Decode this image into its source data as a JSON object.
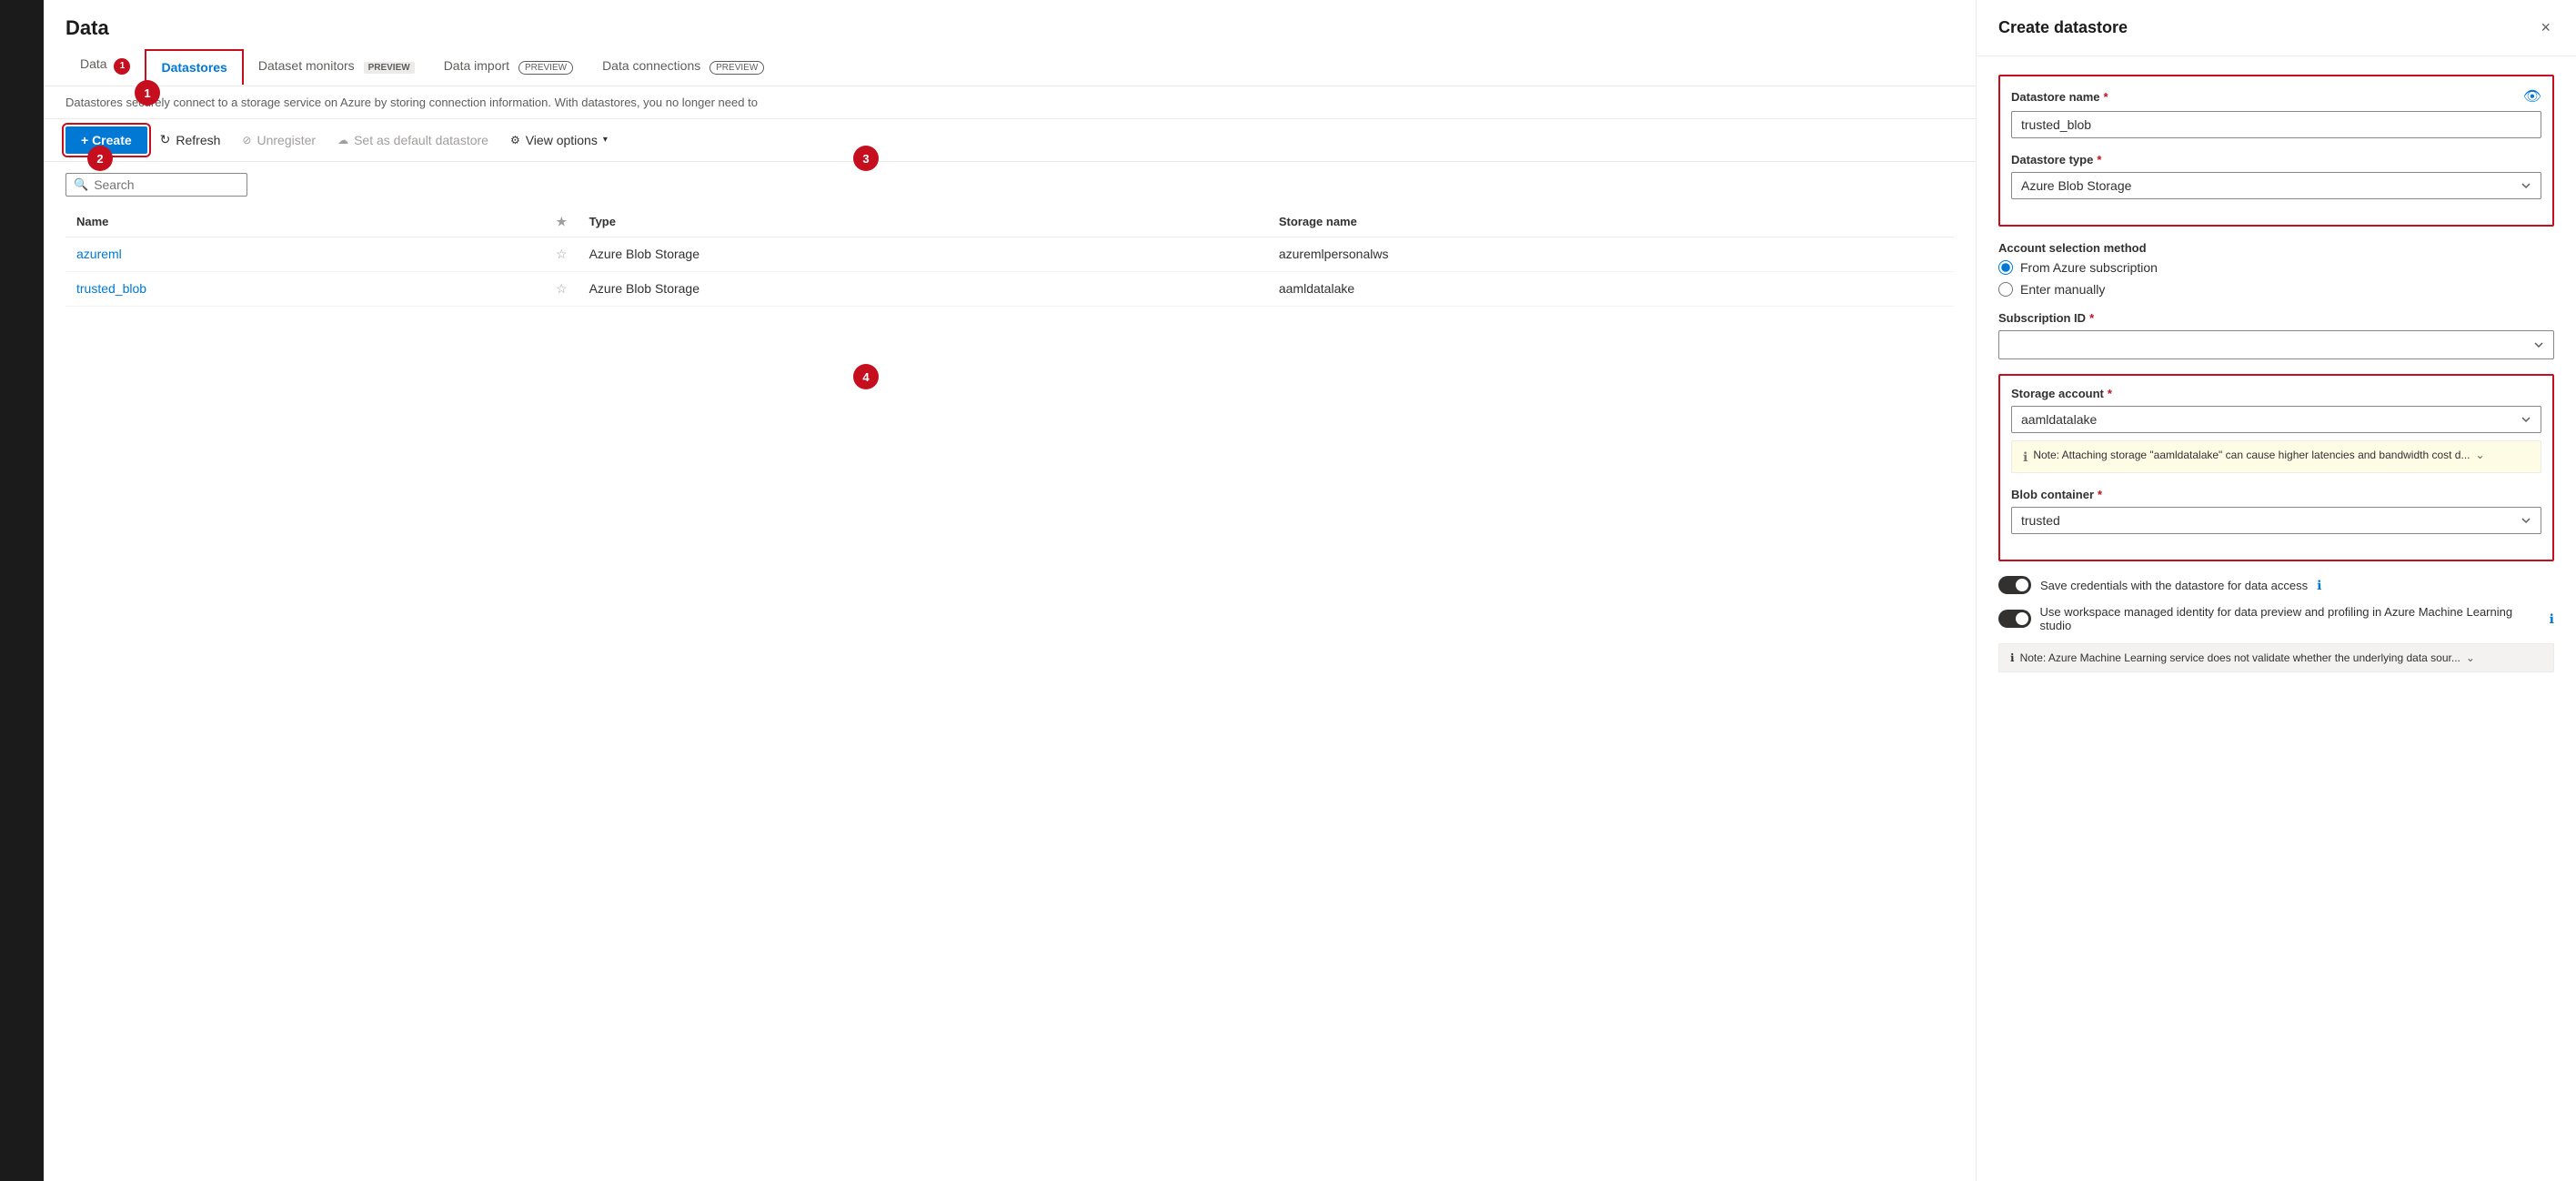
{
  "sidebar": {},
  "page": {
    "title": "Data"
  },
  "tabs": [
    {
      "id": "data",
      "label": "Data",
      "badge": "1",
      "badgeType": "circle",
      "active": false
    },
    {
      "id": "datastores",
      "label": "Datastores",
      "active": true
    },
    {
      "id": "dataset-monitors",
      "label": "Dataset monitors",
      "badge": "PREVIEW",
      "badgeType": "flat",
      "active": false
    },
    {
      "id": "data-import",
      "label": "Data import",
      "badge": "PREVIEW",
      "badgeType": "outline",
      "active": false
    },
    {
      "id": "data-connections",
      "label": "Data connections",
      "badge": "PREVIEW",
      "badgeType": "outline",
      "active": false
    }
  ],
  "description": "Datastores securely connect to a storage service on Azure by storing connection information. With datastores, you no longer need to",
  "toolbar": {
    "create_label": "+ Create",
    "refresh_label": "Refresh",
    "unregister_label": "Unregister",
    "set_default_label": "Set as default datastore",
    "view_options_label": "View options"
  },
  "search": {
    "placeholder": "Search"
  },
  "table": {
    "columns": [
      "Name",
      "",
      "Type",
      "Storage name"
    ],
    "rows": [
      {
        "name": "azureml",
        "type": "Azure Blob Storage",
        "storage": "azuremlpersonalws"
      },
      {
        "name": "trusted_blob",
        "type": "Azure Blob Storage",
        "storage": "aamldatalake"
      }
    ]
  },
  "steps": [
    {
      "number": "1"
    },
    {
      "number": "2"
    },
    {
      "number": "3"
    },
    {
      "number": "4"
    }
  ],
  "panel": {
    "title": "Create datastore",
    "close_label": "×",
    "datastore_name_label": "Datastore name",
    "datastore_name_value": "trusted_blob",
    "datastore_type_label": "Datastore type",
    "datastore_type_value": "Azure Blob Storage",
    "account_selection_label": "Account selection method",
    "radio_azure": "From Azure subscription",
    "radio_manual": "Enter manually",
    "subscription_id_label": "Subscription ID",
    "storage_account_label": "Storage account",
    "storage_account_value": "aamldatalake",
    "note_text": "Note: Attaching storage \"aamldatalake\" can cause higher latencies and bandwidth cost d...",
    "blob_container_label": "Blob container",
    "blob_container_value": "trusted",
    "save_credentials_label": "Save credentials with the datastore for data access",
    "managed_identity_label": "Use workspace managed identity for data preview and profiling in Azure Machine Learning studio",
    "note_bottom_text": "Note: Azure Machine Learning service does not validate whether the underlying data sour..."
  }
}
